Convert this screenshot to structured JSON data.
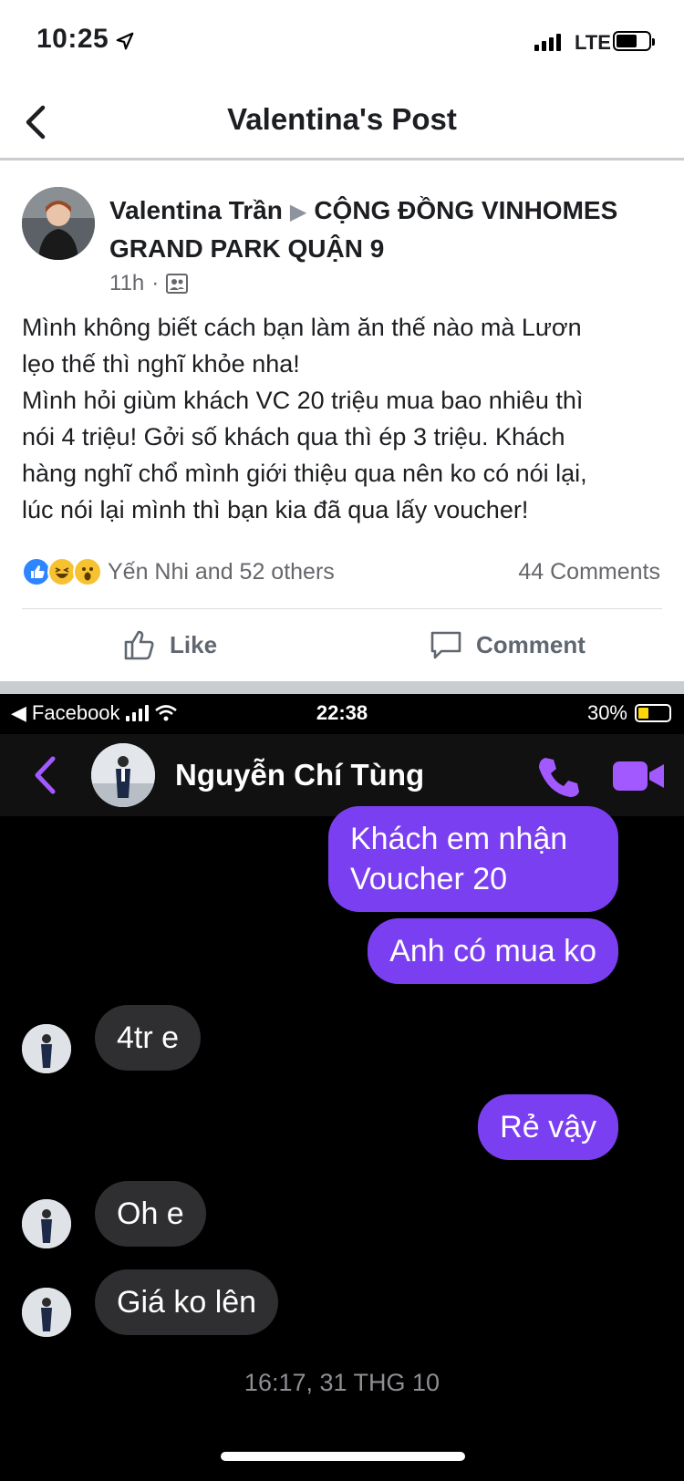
{
  "status_bar": {
    "time": "10:25",
    "network": "LTE",
    "battery_level": 0.65
  },
  "header": {
    "title": "Valentina's Post"
  },
  "post": {
    "author": "Valentina Trần",
    "group": "CỘNG ĐỒNG VINHOMES GRAND PARK QUẬN 9",
    "time": "11h",
    "separator": "·",
    "text": "Mình không biết cách bạn làm ăn thế nào mà Lươn\nlẹo thế thì nghĩ khỏe nha!\nMình hỏi giùm khách VC 20 triệu mua bao nhiêu thì\nnói 4 triệu!  Gởi số khách qua thì ép 3 triệu. Khách\nhàng nghĩ chổ mình giới thiệu qua nên ko có nói lại,\nlúc nói lại mình thì bạn kia đã qua lấy voucher!",
    "reactions_text": "Yến Nhi and 52 others",
    "comments_text": "44 Comments",
    "like_label": "Like",
    "comment_label": "Comment"
  },
  "messenger": {
    "status_left": "Facebook",
    "status_time": "22:38",
    "status_battery": "30%",
    "contact_name": "Nguyễn Chí Tùng",
    "messages": [
      {
        "from": "me",
        "text": "Khách em nhận\nVoucher 20"
      },
      {
        "from": "me",
        "text": "Anh có mua ko"
      },
      {
        "from": "them",
        "text": "4tr e"
      },
      {
        "from": "me",
        "text": "Rẻ vậy"
      },
      {
        "from": "them",
        "text": "Oh e"
      },
      {
        "from": "them",
        "text": "Giá ko lên"
      }
    ],
    "timestamp": "16:17, 31 THG 10"
  },
  "colors": {
    "messenger_purple": "#7b3ff2",
    "fb_blue": "#2d86ff",
    "incoming_bubble": "#2f2f31",
    "call_icon": "#a259ff"
  }
}
